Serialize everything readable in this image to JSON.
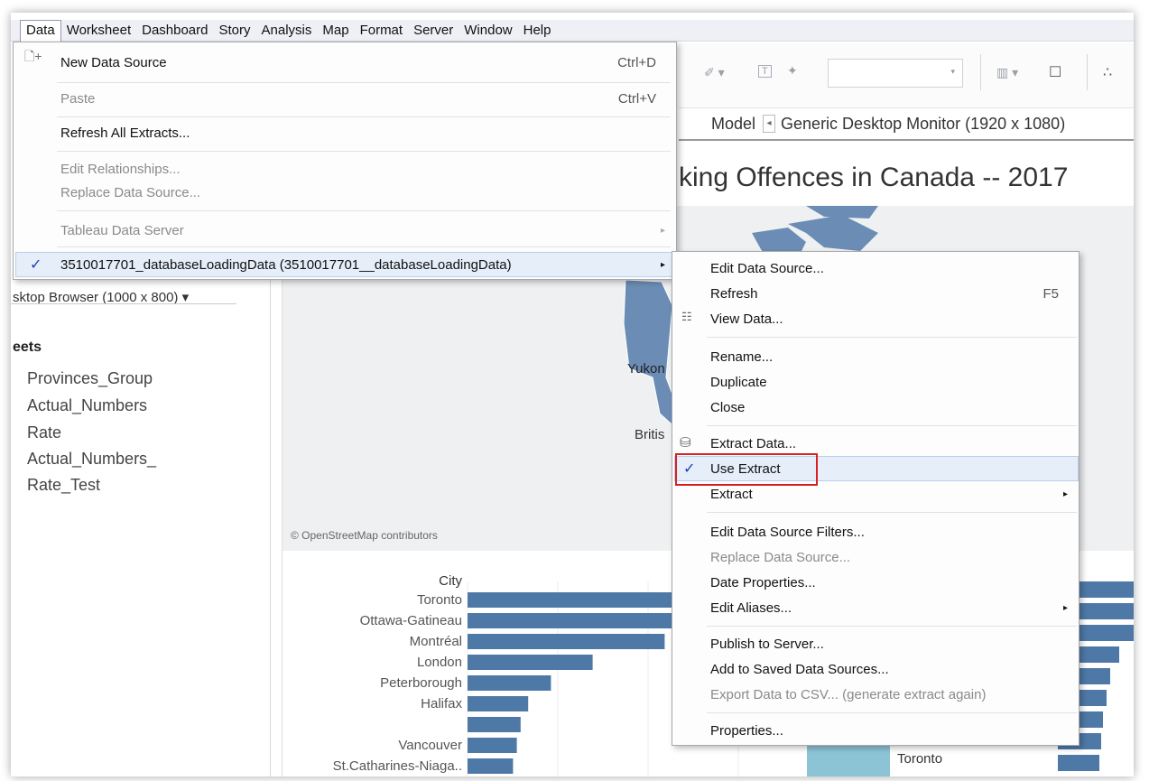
{
  "menubar": [
    "Data",
    "Worksheet",
    "Dashboard",
    "Story",
    "Analysis",
    "Map",
    "Format",
    "Server",
    "Window",
    "Help"
  ],
  "model": {
    "label": "Model",
    "value": "Generic Desktop Monitor (1920 x 1080)"
  },
  "title": "king Offences in Canada -- 2017",
  "left": {
    "device": "sktop Browser (1000 x 800)",
    "sheets_header": "eets",
    "sheets": [
      "Provinces_Group",
      "Actual_Numbers",
      "Rate",
      "Actual_Numbers_",
      "Rate_Test"
    ]
  },
  "map": {
    "labels": [
      "Yukon",
      "Britis"
    ],
    "attribution": "© OpenStreetMap contributors"
  },
  "chart_data": {
    "type": "bar",
    "title": "",
    "ylabel": "City",
    "categories": [
      "Toronto",
      "Ottawa-Gatineau",
      "Montréal",
      "London",
      "Peterborough",
      "Halifax",
      "",
      "Vancouver",
      "St.Catharines-Niaga.."
    ],
    "values": [
      100,
      80,
      52,
      33,
      22,
      16,
      14,
      13,
      12
    ]
  },
  "toronto_label": "Toronto",
  "data_menu": {
    "items": [
      {
        "label": "New Data Source",
        "shortcut": "Ctrl+D",
        "icon": "new-data-source-icon"
      },
      {
        "label": "Paste",
        "shortcut": "Ctrl+V",
        "disabled": true
      },
      {
        "label": "Refresh All Extracts..."
      },
      {
        "label": "Edit Relationships...",
        "disabled": true
      },
      {
        "label": "Replace Data Source...",
        "disabled": true
      },
      {
        "label": "Tableau Data Server",
        "disabled": true
      },
      {
        "label": "3510017701_databaseLoadingData  (3510017701__databaseLoadingData)",
        "checked": true
      }
    ]
  },
  "context_menu": {
    "items": [
      {
        "label": "Edit Data Source..."
      },
      {
        "label": "Refresh",
        "shortcut": "F5"
      },
      {
        "label": "View Data...",
        "icon": "view-data-icon"
      },
      {
        "label": "Rename..."
      },
      {
        "label": "Duplicate"
      },
      {
        "label": "Close"
      },
      {
        "label": "Extract Data...",
        "icon": "extract-data-icon"
      },
      {
        "label": "Use Extract",
        "checked": true
      },
      {
        "label": "Extract"
      },
      {
        "label": "Edit Data Source Filters..."
      },
      {
        "label": "Replace Data Source...",
        "disabled": true
      },
      {
        "label": "Date Properties..."
      },
      {
        "label": "Edit Aliases..."
      },
      {
        "label": "Publish to Server..."
      },
      {
        "label": "Add to Saved Data Sources..."
      },
      {
        "label": "Export Data to CSV... (generate extract again)",
        "disabled": true
      },
      {
        "label": "Properties..."
      }
    ]
  },
  "colors": {
    "bar": "#4e79a7",
    "map_fill": "#6b8db5",
    "light_bar": "#8cc4d6",
    "highlight_border": "#d92020",
    "check": "#1a3fb4"
  }
}
